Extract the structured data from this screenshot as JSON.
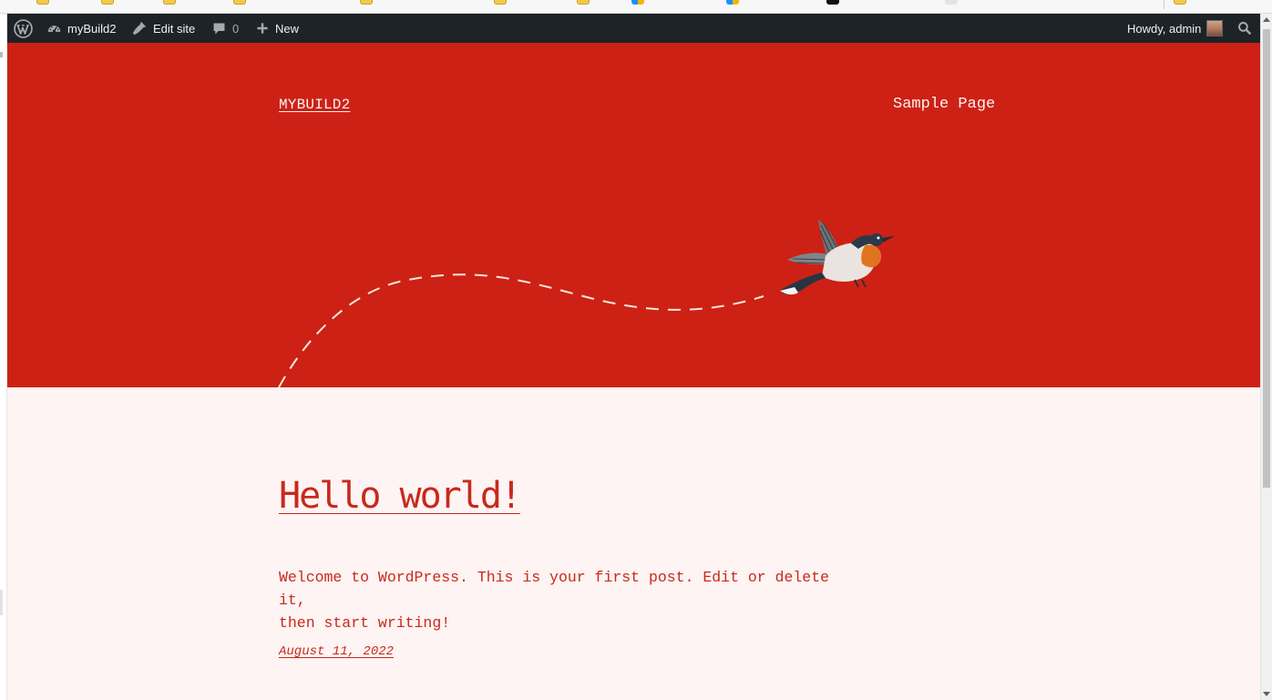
{
  "adminbar": {
    "site_name": "myBuild2",
    "edit_site": "Edit site",
    "comments_count": "0",
    "new_label": "New",
    "howdy": "Howdy, admin"
  },
  "header": {
    "site_title": "MYBUILD2",
    "nav": [
      "Sample Page"
    ]
  },
  "post": {
    "title": "Hello world!",
    "excerpt_line1": "Welcome to WordPress. This is your first post. Edit or delete it,",
    "excerpt_line2": "then start writing!",
    "date": "August 11, 2022"
  },
  "icons": {
    "wp_logo": "wordpress-icon",
    "dashboard": "dashboard-icon",
    "edit": "brush-icon",
    "comments": "comment-icon",
    "new": "plus-icon",
    "search": "search-icon"
  },
  "colors": {
    "accent": "#cd2115",
    "text_accent": "#c8291c",
    "background": "#fdf4f3",
    "adminbar": "#1d2327"
  }
}
